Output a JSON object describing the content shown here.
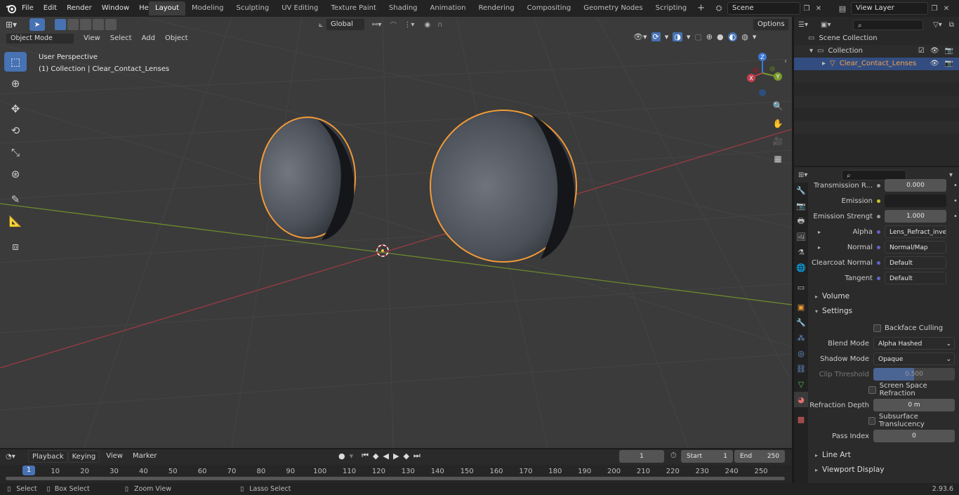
{
  "topbar": {
    "menu": [
      "File",
      "Edit",
      "Render",
      "Window",
      "Help"
    ],
    "workspaces": [
      "Layout",
      "Modeling",
      "Sculpting",
      "UV Editing",
      "Texture Paint",
      "Shading",
      "Animation",
      "Rendering",
      "Compositing",
      "Geometry Nodes",
      "Scripting"
    ],
    "active_workspace": "Layout",
    "add_tab": "+",
    "scene": "Scene",
    "view_layer": "View Layer"
  },
  "viewport": {
    "transform_orientation": "Global",
    "mode": "Object Mode",
    "header_menu": [
      "View",
      "Select",
      "Add",
      "Object"
    ],
    "options": "Options",
    "overlay_title": "User Perspective",
    "overlay_subtitle": "(1) Collection | Clear_Contact_Lenses",
    "gizmo": {
      "x": "X",
      "y": "Y",
      "z": "Z"
    }
  },
  "outliner": {
    "rows": [
      {
        "label": "Scene Collection"
      },
      {
        "label": "Collection"
      },
      {
        "label": "Clear_Contact_Lenses"
      }
    ]
  },
  "properties": {
    "rows": {
      "transmission": {
        "label": "Transmission R...",
        "value": "0.000"
      },
      "emission": {
        "label": "Emission"
      },
      "emission_strength": {
        "label": "Emission Strengt",
        "value": "1.000"
      },
      "alpha": {
        "label": "Alpha",
        "value": "Lens_Refract_invert..."
      },
      "normal": {
        "label": "Normal",
        "value": "Normal/Map"
      },
      "clearcoat_normal": {
        "label": "Clearcoat Normal",
        "value": "Default"
      },
      "tangent": {
        "label": "Tangent",
        "value": "Default"
      }
    },
    "sections": {
      "volume": "Volume",
      "settings": "Settings",
      "line_art": "Line Art",
      "viewport_display": "Viewport Display"
    },
    "settings": {
      "backface_culling": "Backface Culling",
      "blend_mode_label": "Blend Mode",
      "blend_mode": "Alpha Hashed",
      "shadow_mode_label": "Shadow Mode",
      "shadow_mode": "Opaque",
      "clip_threshold_label": "Clip Threshold",
      "clip_threshold": "0.500",
      "ssr": "Screen Space Refraction",
      "refraction_depth_label": "Refraction Depth",
      "refraction_depth": "0 m",
      "subsurface": "Subsurface Translucency",
      "pass_index_label": "Pass Index",
      "pass_index": "0"
    }
  },
  "timeline": {
    "menu": [
      "Playback",
      "Keying",
      "View",
      "Marker"
    ],
    "current_frame": "1",
    "start_label": "Start",
    "start": "1",
    "end_label": "End",
    "end": "250",
    "ruler": [
      "1",
      "10",
      "20",
      "30",
      "40",
      "50",
      "60",
      "70",
      "80",
      "90",
      "100",
      "110",
      "120",
      "130",
      "140",
      "150",
      "160",
      "170",
      "180",
      "190",
      "200",
      "210",
      "220",
      "230",
      "240",
      "250"
    ]
  },
  "statusbar": {
    "select": "Select",
    "box_select": "Box Select",
    "zoom_view": "Zoom View",
    "lasso_select": "Lasso Select",
    "version": "2.93.6"
  },
  "colors": {
    "accent": "#4772b3",
    "selection_outline": "#f29a36",
    "x_axis": "#c2404e",
    "y_axis": "#7a9a2c",
    "z_axis": "#3b78d6"
  }
}
